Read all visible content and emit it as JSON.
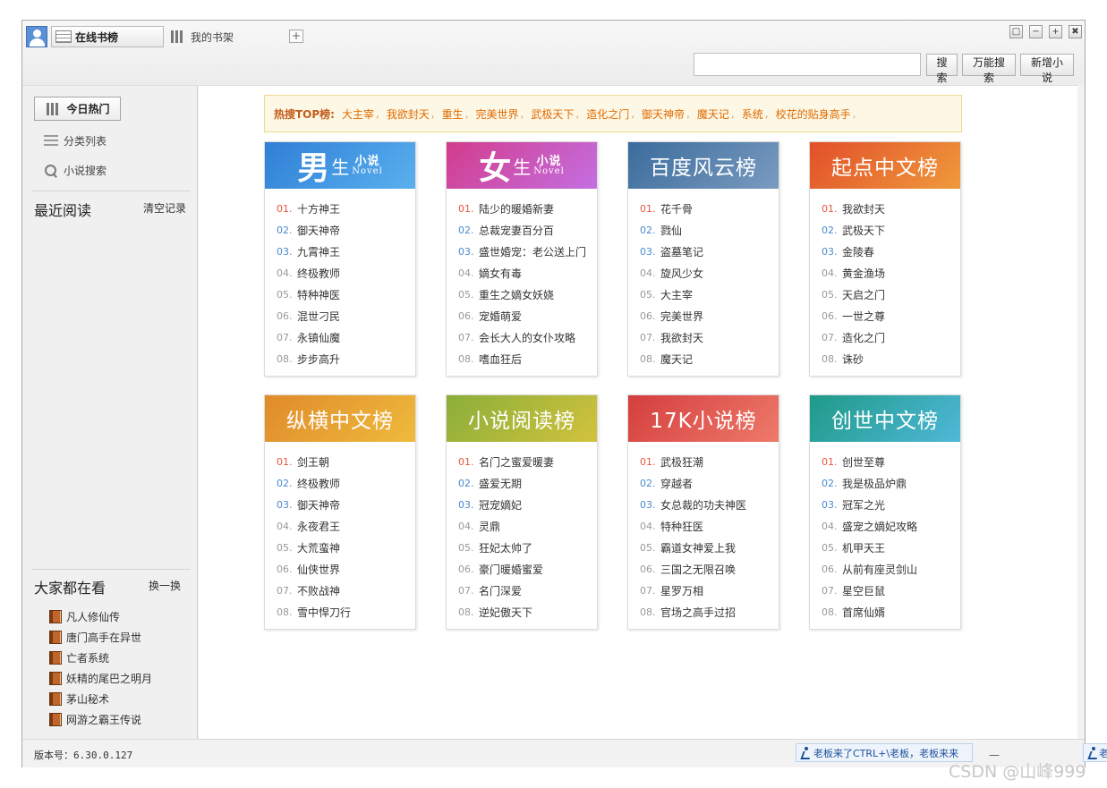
{
  "topbar": {
    "tabs": [
      {
        "label": "在线书榜",
        "icon": "grid-icon"
      },
      {
        "label": "我的书架",
        "icon": "bookshelf-icon"
      }
    ],
    "add_tab_label": "+",
    "window_buttons": {
      "restore": "□",
      "minimize": "−",
      "pin": "+",
      "close": "✖"
    },
    "search_placeholder": "",
    "buttons": {
      "search": "搜索",
      "universal_search": "万能搜索",
      "add_novel": "新增小说"
    }
  },
  "sidebar": {
    "nav": [
      {
        "label": "今日热门",
        "icon": "bookshelf-icon"
      },
      {
        "label": "分类列表",
        "icon": "list-icon"
      },
      {
        "label": "小说搜索",
        "icon": "search-icon"
      }
    ],
    "recent": {
      "title": "最近阅读",
      "clear_label": "清空记录"
    },
    "popular": {
      "title": "大家都在看",
      "refresh_label": "换一换",
      "items": [
        "凡人修仙传",
        "唐门高手在异世",
        "亡者系统",
        "妖精的尾巴之明月",
        "茅山秘术",
        "网游之霸王传说"
      ]
    }
  },
  "hot": {
    "label": "热搜TOP榜:",
    "items": [
      "大主宰",
      "我欲封天",
      "重生",
      "完美世界",
      "武极天下",
      "造化之门",
      "御天神帝",
      "魔天记",
      "系统",
      "校花的贴身高手"
    ],
    "separator": ","
  },
  "cards": [
    {
      "title_big": "男",
      "title_mid": "生",
      "title_small": "小说",
      "title_en": "Novel",
      "gradient": [
        "#2f7fd6",
        "#5ab0ee"
      ],
      "items": [
        [
          "01.",
          "十方神王"
        ],
        [
          "02.",
          "御天神帝"
        ],
        [
          "03.",
          "九霄神王"
        ],
        [
          "04.",
          "终极教师"
        ],
        [
          "05.",
          "特种神医"
        ],
        [
          "06.",
          "混世刁民"
        ],
        [
          "07.",
          "永镇仙魔"
        ],
        [
          "08.",
          "步步高升"
        ]
      ]
    },
    {
      "title_big": "女",
      "title_mid": "生",
      "title_small": "小说",
      "title_en": "Novel",
      "gradient": [
        "#d23c8c",
        "#c46fe2"
      ],
      "items": [
        [
          "01.",
          "陆少的暖婚新妻"
        ],
        [
          "02.",
          "总裁宠妻百分百"
        ],
        [
          "03.",
          "盛世婚宠：老公送上门"
        ],
        [
          "04.",
          "嫡女有毒"
        ],
        [
          "05.",
          "重生之嫡女妖娆"
        ],
        [
          "06.",
          "宠婚萌爱"
        ],
        [
          "07.",
          "会长大人的女仆攻略"
        ],
        [
          "08.",
          "嗜血狂后"
        ]
      ]
    },
    {
      "title": "百度风云榜",
      "gradient": [
        "#3b6c9c",
        "#7a9bc0"
      ],
      "items": [
        [
          "01.",
          "花千骨"
        ],
        [
          "02.",
          "戮仙"
        ],
        [
          "03.",
          "盗墓笔记"
        ],
        [
          "04.",
          "旋风少女"
        ],
        [
          "05.",
          "大主宰"
        ],
        [
          "06.",
          "完美世界"
        ],
        [
          "07.",
          "我欲封天"
        ],
        [
          "08.",
          "魔天记"
        ]
      ]
    },
    {
      "title": "起点中文榜",
      "gradient": [
        "#e2502a",
        "#ef9a3c"
      ],
      "items": [
        [
          "01.",
          "我欲封天"
        ],
        [
          "02.",
          "武极天下"
        ],
        [
          "03.",
          "金陵春"
        ],
        [
          "04.",
          "黄金渔场"
        ],
        [
          "05.",
          "天启之门"
        ],
        [
          "06.",
          "一世之尊"
        ],
        [
          "07.",
          "造化之门"
        ],
        [
          "08.",
          "诛砂"
        ]
      ]
    },
    {
      "title": "纵横中文榜",
      "gradient": [
        "#e08a2a",
        "#efbb3d"
      ],
      "items": [
        [
          "01.",
          "剑王朝"
        ],
        [
          "02.",
          "终极教师"
        ],
        [
          "03.",
          "御天神帝"
        ],
        [
          "04.",
          "永夜君王"
        ],
        [
          "05.",
          "大荒蛮神"
        ],
        [
          "06.",
          "仙侠世界"
        ],
        [
          "07.",
          "不败战神"
        ],
        [
          "08.",
          "雪中悍刀行"
        ]
      ]
    },
    {
      "title": "小说阅读榜",
      "gradient": [
        "#8aae3a",
        "#d2c23c"
      ],
      "items": [
        [
          "01.",
          "名门之蜜爱暖妻"
        ],
        [
          "02.",
          "盛爱无期"
        ],
        [
          "03.",
          "冠宠嫡妃"
        ],
        [
          "04.",
          "灵鼎"
        ],
        [
          "05.",
          "狂妃太帅了"
        ],
        [
          "06.",
          "豪门暖婚蜜爱"
        ],
        [
          "07.",
          "名门深爱"
        ],
        [
          "08.",
          "逆妃傲天下"
        ]
      ]
    },
    {
      "title": "17K小说榜",
      "gradient": [
        "#d43e3e",
        "#ee7a6a"
      ],
      "items": [
        [
          "01.",
          "武极狂潮"
        ],
        [
          "02.",
          "穿越者"
        ],
        [
          "03.",
          "女总裁的功夫神医"
        ],
        [
          "04.",
          "特种狂医"
        ],
        [
          "05.",
          "霸道女神爱上我"
        ],
        [
          "06.",
          "三国之无限召唤"
        ],
        [
          "07.",
          "星罗万相"
        ],
        [
          "08.",
          "官场之高手过招"
        ]
      ]
    },
    {
      "title": "创世中文榜",
      "gradient": [
        "#1f9a88",
        "#4fb8d8"
      ],
      "items": [
        [
          "01.",
          "创世至尊"
        ],
        [
          "02.",
          "我是极品炉鼎"
        ],
        [
          "03.",
          "冠军之光"
        ],
        [
          "04.",
          "盛宠之嫡妃攻略"
        ],
        [
          "05.",
          "机甲天王"
        ],
        [
          "06.",
          "从前有座灵剑山"
        ],
        [
          "07.",
          "星空巨鼠"
        ],
        [
          "08.",
          "首席仙婿"
        ]
      ]
    }
  ],
  "status": {
    "version": "版本号：6.30.0.127",
    "boss_key": "老板来了CTRL+\\老板，老板来来",
    "dash": "—",
    "boss_key_short": "老"
  },
  "watermark": "CSDN @山峰999"
}
